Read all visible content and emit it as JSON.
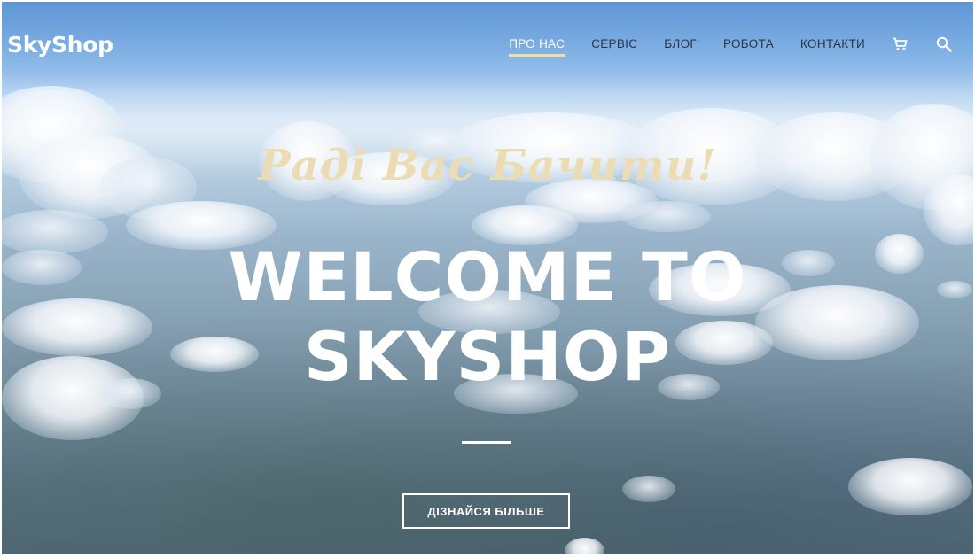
{
  "header": {
    "logo": "SkyShop",
    "nav": [
      {
        "label": "ПРО НАС",
        "active": true
      },
      {
        "label": "СЕРВІС",
        "active": false
      },
      {
        "label": "БЛОГ",
        "active": false
      },
      {
        "label": "РОБОТА",
        "active": false
      },
      {
        "label": "КОНТАКТИ",
        "active": false
      }
    ],
    "icons": [
      "cart-icon",
      "search-icon"
    ]
  },
  "hero": {
    "tagline": "Раді Вас Бачити!",
    "title_line1": "WELCOME TO",
    "title_line2": "SKYSHOP",
    "cta_label": "ДІЗНАЙСЯ БІЛЬШЕ"
  },
  "colors": {
    "tagline": "#ecdcb4",
    "active_underline": "#f1dea0",
    "nav_text": "#2e3440",
    "accent_white": "#ffffff"
  }
}
